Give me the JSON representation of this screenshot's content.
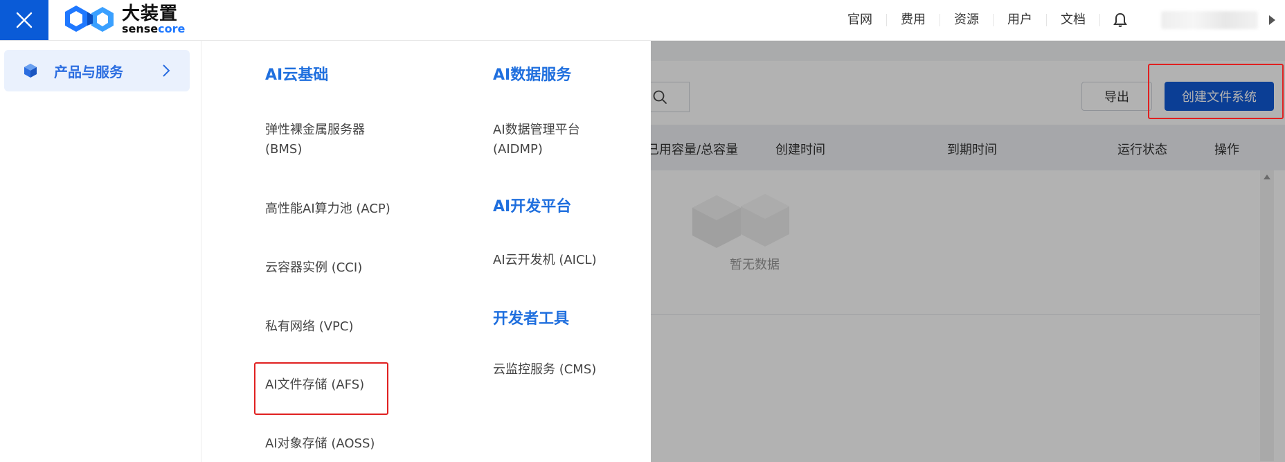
{
  "header": {
    "logo_cn": "大装置",
    "logo_en_a": "sense",
    "logo_en_b": "core",
    "nav": [
      "官网",
      "费用",
      "资源",
      "用户",
      "文档"
    ]
  },
  "sidebar": {
    "items": [
      {
        "label": "产品与服务",
        "icon": "cube-icon"
      }
    ]
  },
  "menu": {
    "col1": {
      "category": "AI云基础",
      "items": [
        "弹性裸金属服务器\n(BMS)",
        "高性能AI算力池 (ACP)",
        "云容器实例 (CCI)",
        "私有网络 (VPC)",
        "AI文件存储 (AFS)",
        "AI对象存储 (AOSS)"
      ]
    },
    "col2": {
      "cat1": "AI数据服务",
      "cat1_items": [
        "AI数据管理平台\n(AIDMP)"
      ],
      "cat2": "AI开发平台",
      "cat2_items": [
        "AI云开发机 (AICL)"
      ],
      "cat3": "开发者工具",
      "cat3_items": [
        "云监控服务 (CMS)"
      ]
    }
  },
  "background_page": {
    "export_label": "导出",
    "create_label": "创建文件系统",
    "table_headers": [
      "已用容量/总容量",
      "创建时间",
      "到期时间",
      "运行状态",
      "操作"
    ],
    "empty_text": "暂无数据"
  },
  "colors": {
    "primary": "#0a5bd7",
    "category": "#1f6fde",
    "highlight_box": "#e02020"
  }
}
